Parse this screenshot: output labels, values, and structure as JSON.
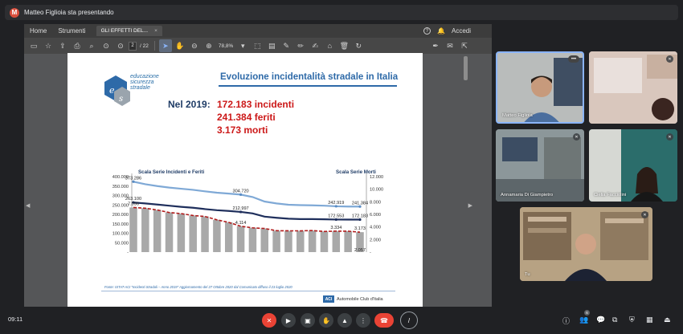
{
  "meeting": {
    "presenter_initial": "M",
    "presenting_text": "Matteo Figlioia sta presentando",
    "time": "09:11",
    "participant_count": "6"
  },
  "viewer": {
    "menu": [
      "Home",
      "Strumenti"
    ],
    "doc_tab": "GLI EFFETTI DEL...",
    "doc_tab_close": "×",
    "signin": "Accedi",
    "help_icon": "?",
    "page_current": "2",
    "page_total": "/ 22",
    "zoom": "78,8%"
  },
  "slide": {
    "logo_text": "educazione sicurezza stradale",
    "title": "Evoluzione incidentalità stradale in Italia",
    "year_label": "Nel 2019:",
    "stats": [
      "172.183  incidenti",
      "241.384  feriti",
      "3.173  morti"
    ],
    "source": "Fonte: ISTAT-ACI \"Incidenti Stradali – Anno 2019\" Aggiornamento del 27 Ottobre 2020  dal Comunicato diffuso il 23 luglio 2020",
    "org_mark": "ACI",
    "org_name": "Automobile Club d'Italia"
  },
  "chart_data": {
    "type": "line",
    "left_axis_label": "Scala Serie Incidenti e Feriti",
    "right_axis_label": "Scala Serie Morti",
    "left_ticks": [
      "400.000",
      "350.000",
      "300.000",
      "250.000",
      "200.000",
      "150.000",
      "100.000",
      "50.000",
      "-"
    ],
    "right_ticks": [
      "12.000",
      "10.000",
      "8.000",
      "6.000",
      "4.000",
      "2.000",
      "-"
    ],
    "ylim_left": [
      0,
      400000
    ],
    "ylim_right": [
      0,
      12000
    ],
    "num_years": 20,
    "series": [
      {
        "name": "Feriti",
        "color": "#7fa9d6",
        "values": [
          373286,
          360000,
          350000,
          342000,
          336000,
          330000,
          322000,
          315000,
          310000,
          304720,
          292000,
          268000,
          258000,
          251000,
          249000,
          248000,
          246000,
          242919,
          241600,
          241384
        ]
      },
      {
        "name": "Incidenti",
        "color": "#1f2f5c",
        "values": [
          263100,
          258000,
          252000,
          246000,
          240000,
          235000,
          228000,
          222000,
          218000,
          212997,
          205000,
          188000,
          182000,
          177000,
          175000,
          174900,
          174000,
          172553,
          172300,
          172183
        ]
      },
      {
        "name": "Morti",
        "color": "#b01c1c",
        "axis": "right",
        "values": [
          7096,
          6980,
          6700,
          6300,
          6120,
          5818,
          5669,
          5131,
          4725,
          4114,
          3860,
          3753,
          3401,
          3385,
          3381,
          3428,
          3283,
          3334,
          3325,
          3173
        ]
      }
    ],
    "labels": {
      "feriti": [
        "373.286",
        "304.720",
        "242.919",
        "241.384"
      ],
      "incidenti": [
        "263.100",
        "212.997",
        "172.553",
        "172.183"
      ],
      "morti": [
        "7.096",
        "4.114",
        "3.334",
        "3.173",
        "2.057"
      ]
    }
  },
  "participants": [
    {
      "name": "Matteo Figlioia"
    },
    {
      "name": ""
    },
    {
      "name": "Annamaria Di Giampietro"
    },
    {
      "name": "Cielia Facciolini"
    },
    {
      "name": "Tu"
    }
  ],
  "colors": {
    "accent": "#8ab4f8",
    "danger": "#ea4335",
    "slide_blue": "#2e6aa8",
    "stat_red": "#cc1818"
  }
}
